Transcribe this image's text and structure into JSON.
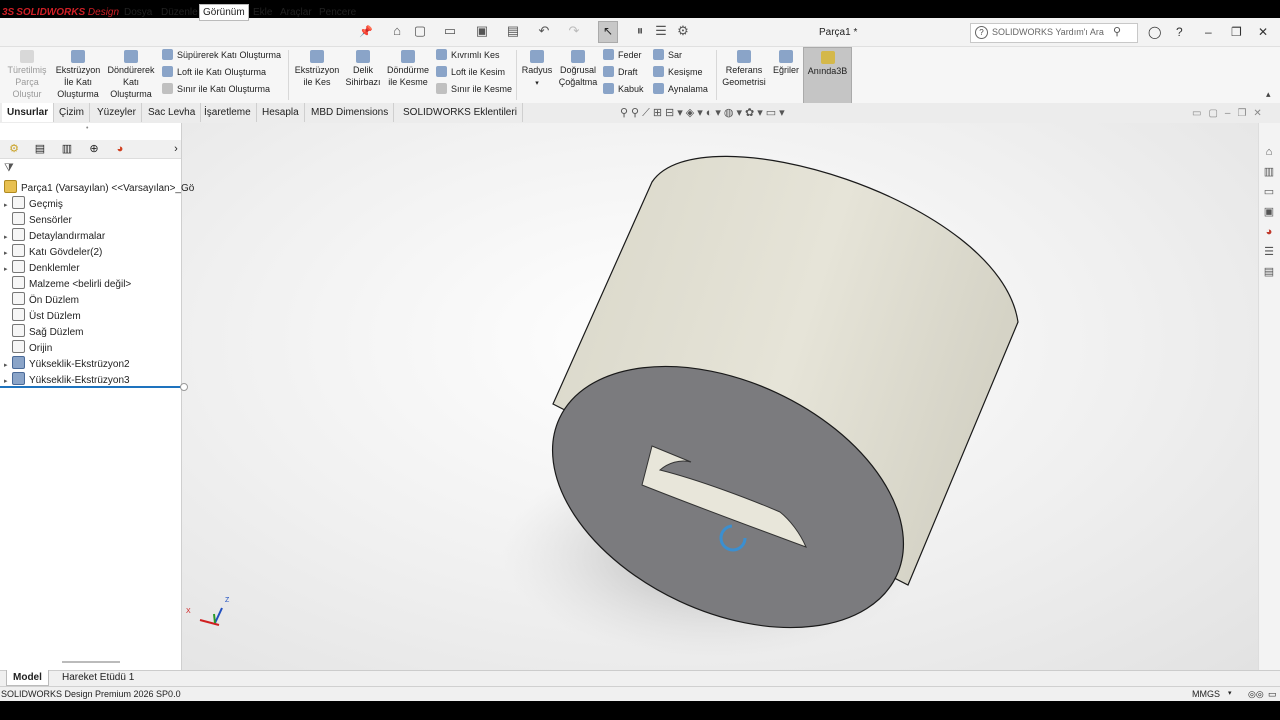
{
  "app": {
    "logo_text": "SOLIDWORKS",
    "logo_suffix": "Design",
    "doc_title": "Parça1 *"
  },
  "menu": [
    "Dosya",
    "Düzenle",
    "Görünüm",
    "Ekle",
    "Araçlar",
    "Pencere"
  ],
  "search": {
    "placeholder": "SOLIDWORKS Yardım'ı Ara"
  },
  "ribbon": {
    "boss_base": "Türetilmiş Parça Oluştur",
    "extrude": [
      "Ekstrüzyon",
      "İle Katı",
      "Oluşturma"
    ],
    "revolve": [
      "Döndürerek",
      "Katı",
      "Oluşturma"
    ],
    "sweep": "Süpürerek Katı Oluşturma",
    "loft": "Loft ile Katı Oluşturma",
    "boundary": "Sınır ile Katı Oluşturma",
    "extruded_cut": [
      "Ekstrüzyon",
      "ile Kes"
    ],
    "hole_wizard": [
      "Delik",
      "Sihirbazı"
    ],
    "revolved_cut": [
      "Döndürme",
      "ile Kesme"
    ],
    "swept_cut": "Kıvrımlı Kes",
    "lofted_cut": "Loft ile Kesim",
    "boundary_cut": "Sınır ile Kesme",
    "fillet": "Radyus",
    "linear_pattern": [
      "Doğrusal",
      "Çoğaltma"
    ],
    "rib": "Feder",
    "draft": "Draft",
    "shell": "Kabuk",
    "wrap": "Sar",
    "intersect": "Kesişme",
    "mirror": "Aynalama",
    "reference_geometry": [
      "Referans",
      "Geometrisi"
    ],
    "curves": "Eğriler",
    "instant3d": "Anında3B"
  },
  "tabs": [
    "Unsurlar",
    "Çizim",
    "Yüzeyler",
    "Sac Levha",
    "İşaretleme",
    "Hesapla",
    "MBD Dimensions",
    "SOLIDWORKS Eklentileri"
  ],
  "tree": {
    "root": "Parça1 (Varsayılan) <<Varsayılan>_Gö",
    "items": [
      {
        "label": "Geçmiş",
        "expandable": true
      },
      {
        "label": "Sensörler",
        "expandable": false
      },
      {
        "label": "Detaylandırmalar",
        "expandable": true
      },
      {
        "label": "Katı Gövdeler(2)",
        "expandable": true
      },
      {
        "label": "Denklemler",
        "expandable": true
      },
      {
        "label": "Malzeme <belirli değil>",
        "expandable": false
      },
      {
        "label": "Ön Düzlem",
        "expandable": false
      },
      {
        "label": "Üst Düzlem",
        "expandable": false
      },
      {
        "label": "Sağ Düzlem",
        "expandable": false
      },
      {
        "label": "Orijin",
        "expandable": false
      },
      {
        "label": "Yükseklik-Ekstrüzyon2",
        "expandable": true
      },
      {
        "label": "Yükseklik-Ekstrüzyon3",
        "expandable": true
      }
    ]
  },
  "triad": {
    "z": "Z",
    "x": "X"
  },
  "colors": {
    "cylinder_side": "#e4e2d6",
    "cylinder_face": "#7b7b7e",
    "cut_profile": "#e8e6da",
    "accent_blue": "#1e73be"
  },
  "bottom_tabs": [
    "Model",
    "Hareket Etüdü 1"
  ],
  "status": {
    "left": "SOLIDWORKS Design Premium 2026 SP0.0",
    "units": "MMGS"
  }
}
